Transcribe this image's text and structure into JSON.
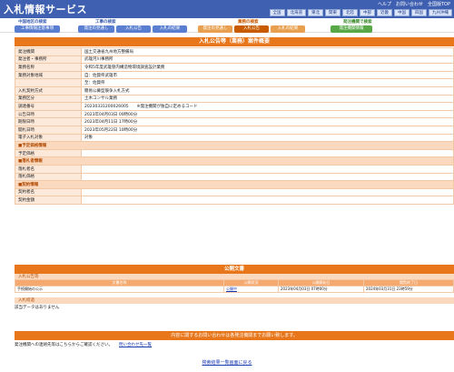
{
  "header": {
    "logo": "入札情報サービス",
    "links": [
      "ヘルプ",
      "お問い合わせ",
      "全国版TOP"
    ],
    "regions": [
      "全国",
      "北海道",
      "東北",
      "関東",
      "北陸",
      "中部",
      "近畿",
      "中国",
      "四国",
      "九州沖縄"
    ]
  },
  "nav": {
    "groups": [
      "中国地区の検索",
      "工事の検索",
      "業務の検索",
      "発注機関で検索"
    ],
    "buttons": [
      "工事情報注意事項",
      "発注の見通し",
      "入札公告",
      "入札の結果",
      "発注の見通し",
      "入札公告",
      "入札の結果",
      "発注機関情報"
    ]
  },
  "title": "入札公告等（業務）案件概要",
  "details": [
    {
      "k": "発注機関",
      "v": "国土交通省九州地方整備局"
    },
    {
      "k": "発注者・事務所",
      "v": "武雄河川事務所"
    },
    {
      "k": "業務名称",
      "v": "令和5年度武雄管内構造物環境調査設計業務"
    },
    {
      "k": "業務対象地域",
      "v": "自：佐賀県武雄市"
    },
    {
      "k": "",
      "v": "至：佐賀県"
    },
    {
      "k": "入札契約方式",
      "v": "簡易公募型競争入札方式"
    },
    {
      "k": "業務区分",
      "v": "土木コンサル業務"
    },
    {
      "k": "調達番号",
      "v": "20230331200026005　　※発注機関が独自に定めるコード"
    },
    {
      "k": "公告日時",
      "v": "2023年04月03日 00時00分"
    },
    {
      "k": "期限日時",
      "v": "2023年04月11日 17時00分"
    },
    {
      "k": "開札日時",
      "v": "2023年05月22日 10時00分"
    },
    {
      "k": "電子入札対象",
      "v": "対象"
    },
    {
      "sec": "■予定価格情報"
    },
    {
      "k": "予定価格",
      "v": ""
    },
    {
      "sec": "■落札者情報"
    },
    {
      "k": "落札者名",
      "v": ""
    },
    {
      "k": "落札価格",
      "v": ""
    },
    {
      "sec": "■契約情報"
    },
    {
      "k": "契約者名",
      "v": ""
    },
    {
      "k": "契約金額",
      "v": ""
    }
  ],
  "public_docs": {
    "title": "公開文書",
    "sub1": "入札公告等",
    "headers": [
      "文書名称",
      "公開状況",
      "公開開始日",
      "閲覧終了日"
    ],
    "rows": [
      [
        "手続開始の公示",
        "公開中",
        "2023年04月03日 07時00分",
        "2024年03月31日 23時59分"
      ]
    ],
    "sub2": "入札経過",
    "empty": "該当データはありません"
  },
  "inquiry": {
    "bar": "内容に関するお問い合わせは各発注機関までお願い致します。",
    "text": "発注機関への連絡先等はこちらからご確認ください。",
    "link": "問い合わせ先一覧"
  },
  "back": "検索結果一覧画面に戻る"
}
